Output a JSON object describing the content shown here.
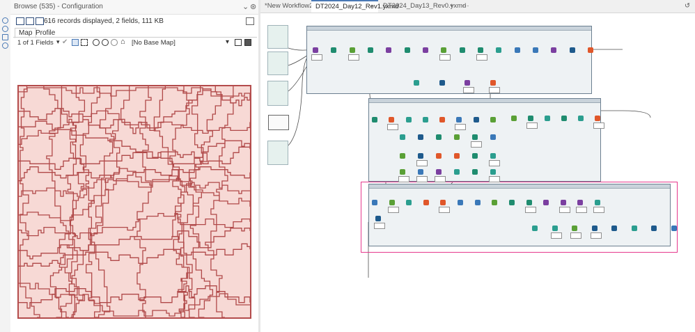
{
  "browse_panel": {
    "title": "Browse (535) - Configuration",
    "pin_icon": "pin-icon",
    "collapse_icon": "chevron-icon",
    "results_info": "616 records displayed, 2 fields, 111 KB",
    "tabs": [
      "Map",
      "Profile"
    ],
    "fields_selector": "1 of 1 Fields",
    "base_map": "[No Base Map]"
  },
  "doc_tabs": [
    {
      "label": "*New Workflow2",
      "active": false
    },
    {
      "label": "DT2024_Day12_Rev1.yxmd",
      "active": true
    },
    {
      "label": "DT2024_Day13_Rev0.yxmd",
      "active": false
    }
  ],
  "doc_tab_controls": {
    "add": "+",
    "more": "···"
  },
  "colors": {
    "accent": "#4a79b5",
    "map_fill": "#f7d9d5",
    "map_stroke": "#b44c4c",
    "highlight": "#e6388d",
    "container_bg": "#eef2f4"
  },
  "icons": {
    "rail": [
      "settings-icon",
      "error-icon",
      "tag-icon",
      "help-icon"
    ],
    "history": "history-icon"
  }
}
